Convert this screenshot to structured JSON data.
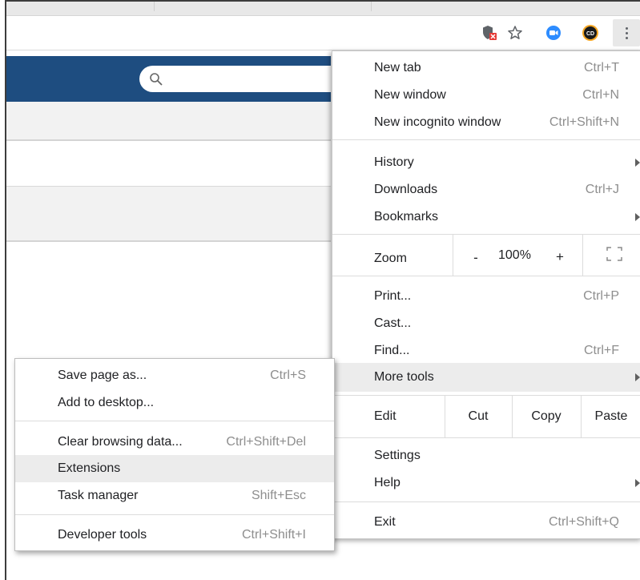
{
  "toolbar": {
    "icons": [
      "shield-blocked-icon",
      "bookmark-star-icon",
      "zoom-extension-icon",
      "cd-extension-icon",
      "more-menu-icon"
    ]
  },
  "page": {
    "search_icon": "search-icon"
  },
  "menu": {
    "new_tab": {
      "label": "New tab",
      "shortcut": "Ctrl+T"
    },
    "new_window": {
      "label": "New window",
      "shortcut": "Ctrl+N"
    },
    "new_incognito": {
      "label": "New incognito window",
      "shortcut": "Ctrl+Shift+N"
    },
    "history": {
      "label": "History"
    },
    "downloads": {
      "label": "Downloads",
      "shortcut": "Ctrl+J"
    },
    "bookmarks": {
      "label": "Bookmarks"
    },
    "zoom": {
      "label": "Zoom",
      "minus": "-",
      "value": "100%",
      "plus": "+"
    },
    "print": {
      "label": "Print...",
      "shortcut": "Ctrl+P"
    },
    "cast": {
      "label": "Cast..."
    },
    "find": {
      "label": "Find...",
      "shortcut": "Ctrl+F"
    },
    "more_tools": {
      "label": "More tools"
    },
    "edit": {
      "label": "Edit",
      "cut": "Cut",
      "copy": "Copy",
      "paste": "Paste"
    },
    "settings": {
      "label": "Settings"
    },
    "help": {
      "label": "Help"
    },
    "exit": {
      "label": "Exit",
      "shortcut": "Ctrl+Shift+Q"
    }
  },
  "submenu": {
    "save_page": {
      "label": "Save page as...",
      "shortcut": "Ctrl+S"
    },
    "add_desktop": {
      "label": "Add to desktop..."
    },
    "clear_data": {
      "label": "Clear browsing data...",
      "shortcut": "Ctrl+Shift+Del"
    },
    "extensions": {
      "label": "Extensions"
    },
    "task_manager": {
      "label": "Task manager",
      "shortcut": "Shift+Esc"
    },
    "dev_tools": {
      "label": "Developer tools",
      "shortcut": "Ctrl+Shift+I"
    }
  },
  "colors": {
    "header_blue": "#1e4d80",
    "zoom_ext_blue": "#2d8cff",
    "highlight": "#ececec"
  }
}
